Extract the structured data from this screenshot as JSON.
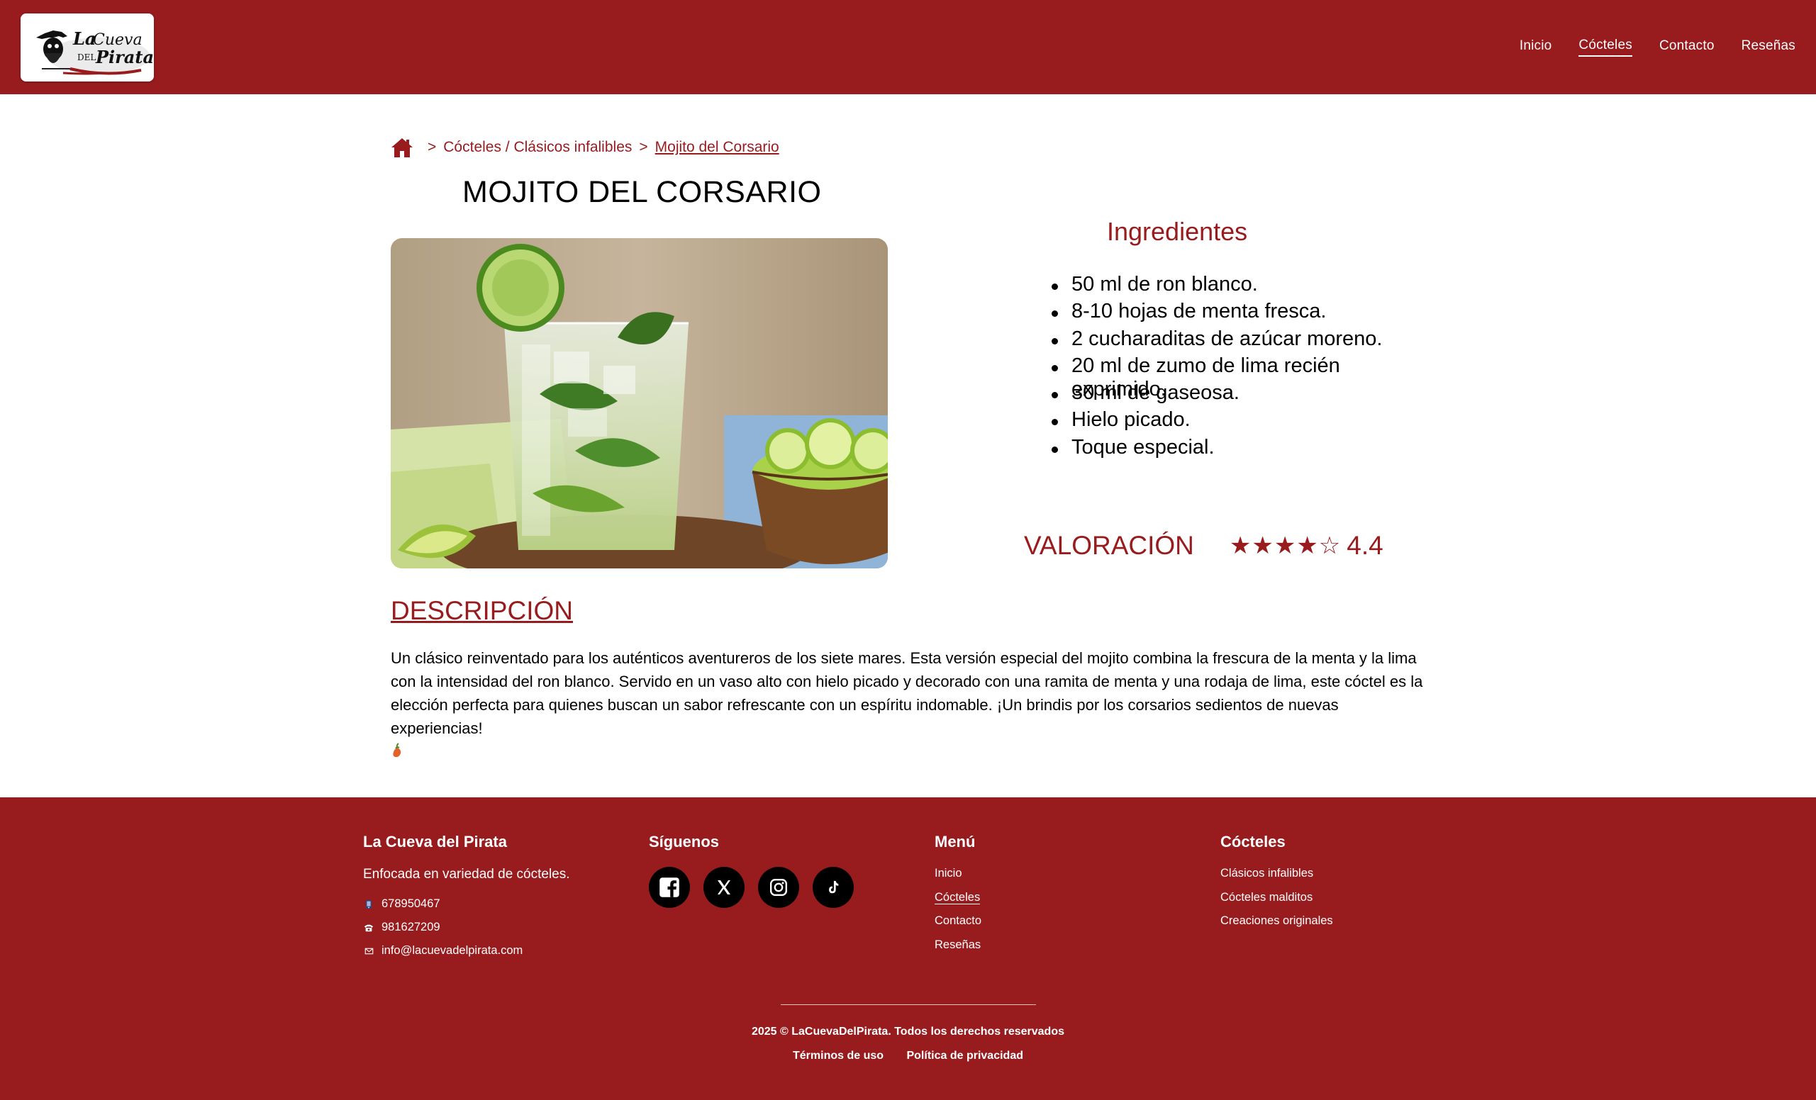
{
  "header": {
    "logo_text": "La Cueva del Pirata",
    "nav": [
      {
        "label": "Inicio",
        "active": false
      },
      {
        "label": "Cócteles",
        "active": true
      },
      {
        "label": "Contacto",
        "active": false
      },
      {
        "label": "Reseñas",
        "active": false
      }
    ]
  },
  "breadcrumb": {
    "home_icon": "home-icon",
    "separator": ">",
    "category": "Cócteles / Clásicos infalibles",
    "current": "Mojito del Corsario"
  },
  "recipe": {
    "title": "MOJITO DEL CORSARIO",
    "ingredients_title": "Ingredientes",
    "ingredients": [
      "50 ml de ron blanco.",
      "8-10 hojas de menta fresca.",
      "2 cucharaditas de azúcar moreno.",
      "20 ml de zumo de lima recién exprimido.",
      "30 ml de gaseosa.",
      "Hielo picado.",
      "Toque especial."
    ],
    "rating_label": "VALORACIÓN",
    "rating_stars": "★★★★☆",
    "rating_value": "4.4",
    "description_title": "DESCRIPCIÓN",
    "description": "Un clásico reinventado para los auténticos aventureros de los siete mares. Esta versión especial del mojito combina la frescura de la menta y la lima con la intensidad del ron blanco. Servido en un vaso alto con hielo picado y decorado con una ramita de menta y una rodaja de lima, este cóctel es la elección perfecta para quienes buscan un sabor refrescante con un espíritu indomable. ¡Un brindis por los corsarios sedientos de nuevas experiencias!",
    "description_emoji": "chili-pepper-icon"
  },
  "footer": {
    "about_title": "La Cueva del Pirata",
    "about_tagline": "Enfocada en variedad de cócteles.",
    "mobile": "678950467",
    "phone": "981627209",
    "email": "info@lacuevadelpirata.com",
    "social_title": "Síguenos",
    "social": [
      "facebook-icon",
      "x-icon",
      "instagram-icon",
      "tiktok-icon"
    ],
    "menu_title": "Menú",
    "menu": [
      "Inicio",
      "Cócteles",
      "Contacto",
      "Reseñas"
    ],
    "cocktails_title": "Cócteles",
    "cocktails": [
      "Clásicos infalibles",
      "Cócteles malditos",
      "Creaciones originales"
    ],
    "copyright": "2025 © LaCuevaDelPirata. Todos los derechos reservados",
    "terms": "Términos de uso",
    "privacy": "Política de privacidad"
  },
  "colors": {
    "brand": "#981b1e",
    "white": "#ffffff",
    "black": "#000000"
  }
}
